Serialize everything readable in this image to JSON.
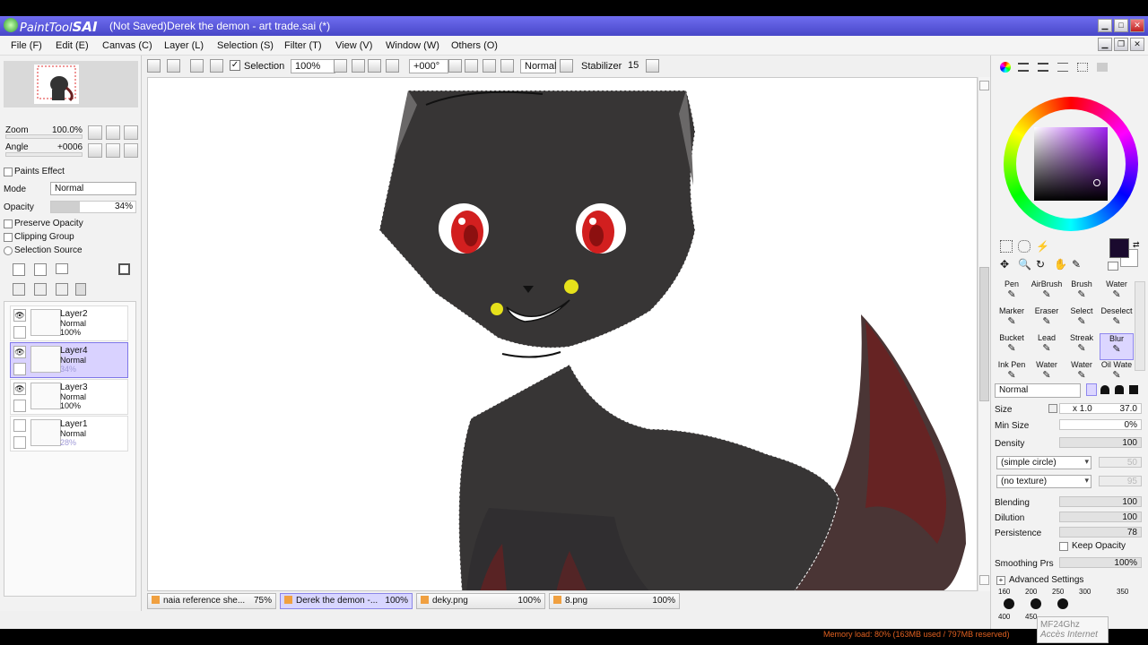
{
  "window": {
    "app_name_prefix": "PaintTool",
    "app_name_bold": "SAI",
    "document_title": "(Not Saved)Derek the demon - art trade.sai (*)"
  },
  "menu": [
    "File (F)",
    "Edit (E)",
    "Canvas (C)",
    "Layer (L)",
    "Selection (S)",
    "Filter (T)",
    "View (V)",
    "Window (W)",
    "Others (O)"
  ],
  "toolbar": {
    "selection_label": "Selection",
    "zoom": "100%",
    "rotation": "+000°",
    "blend_mode": "Normal",
    "stabilizer_label": "Stabilizer",
    "stabilizer_value": "15"
  },
  "navigator": {
    "zoom_label": "Zoom",
    "zoom_value": "100.0%",
    "angle_label": "Angle",
    "angle_value": "+0006"
  },
  "layer_props": {
    "paints_effect": "Paints Effect",
    "mode_label": "Mode",
    "mode_value": "Normal",
    "opacity_label": "Opacity",
    "opacity_value": "34%",
    "opacity_fraction": 0.34,
    "preserve_opacity": "Preserve Opacity",
    "clipping_group": "Clipping Group",
    "selection_source": "Selection Source"
  },
  "layers": [
    {
      "name": "Layer2",
      "mode": "Normal",
      "opacity": "100%",
      "visible": true,
      "selected": false
    },
    {
      "name": "Layer4",
      "mode": "Normal",
      "opacity": "34%",
      "visible": true,
      "selected": true
    },
    {
      "name": "Layer3",
      "mode": "Normal",
      "opacity": "100%",
      "visible": true,
      "selected": false
    },
    {
      "name": "Layer1",
      "mode": "Normal",
      "opacity": "28%",
      "visible": false,
      "selected": false
    }
  ],
  "tabs": [
    {
      "label": "naia reference she...",
      "zoom": "75%",
      "active": false
    },
    {
      "label": "Derek the demon -...",
      "zoom": "100%",
      "active": true
    },
    {
      "label": "deky.png",
      "zoom": "100%",
      "active": false
    },
    {
      "label": "8.png",
      "zoom": "100%",
      "active": false
    }
  ],
  "tools": [
    "Pen",
    "AirBrush",
    "Brush",
    "Water",
    "Marker",
    "Eraser",
    "Select",
    "Deselect",
    "Bucket",
    "Lead",
    "Streak",
    "Blur",
    "Ink Pen",
    "Water",
    "Water",
    "Oil Wate"
  ],
  "selected_tool_index": 11,
  "brush": {
    "mode": "Normal",
    "size_label": "Size",
    "size_multiplier": "x 1.0",
    "size_value": "37.0",
    "min_size_label": "Min Size",
    "min_size_value": "0%",
    "density_label": "Density",
    "density_value": "100",
    "shape": "(simple circle)",
    "shape_value": "50",
    "texture": "(no texture)",
    "texture_value": "95",
    "blending_label": "Blending",
    "blending_value": "100",
    "dilution_label": "Dilution",
    "dilution_value": "100",
    "persistence_label": "Persistence",
    "persistence_value": "78",
    "keep_opacity": "Keep Opacity",
    "smoothing_label": "Smoothing Prs",
    "smoothing_value": "100%",
    "advanced": "Advanced Settings",
    "presets": [
      "160",
      "200",
      "250",
      "300",
      "350",
      "400",
      "450"
    ]
  },
  "status": {
    "memory": "Memory load: 80% (163MB used / 797MB reserved)"
  },
  "tooltip": {
    "line1": "MF24Ghz",
    "line2": "Accès Internet"
  },
  "colors": {
    "title_bar": "#5a58e0",
    "fur": "#373535",
    "eyes": "#d21f1f",
    "tail_red": "#6b2020",
    "selected_layer": "#d9d2ff",
    "memory_text": "#e06020"
  }
}
